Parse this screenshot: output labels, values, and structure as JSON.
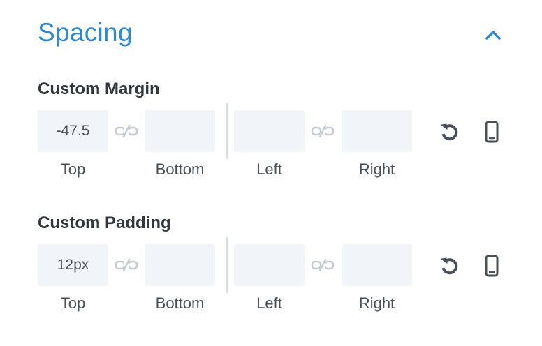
{
  "section": {
    "title": "Spacing",
    "collapse_icon": "chevron-up-icon",
    "accent_color": "#2b87da"
  },
  "custom_margin": {
    "label": "Custom Margin",
    "top_value": "-47.5",
    "bottom_value": "",
    "left_value": "",
    "right_value": "",
    "labels": {
      "top": "Top",
      "bottom": "Bottom",
      "left": "Left",
      "right": "Right"
    }
  },
  "custom_padding": {
    "label": "Custom Padding",
    "top_value": "12px",
    "bottom_value": "",
    "left_value": "",
    "right_value": "",
    "labels": {
      "top": "Top",
      "bottom": "Bottom",
      "left": "Left",
      "right": "Right"
    }
  },
  "icons": {
    "link": "link-icon",
    "reset": "undo-icon",
    "responsive": "mobile-icon"
  }
}
